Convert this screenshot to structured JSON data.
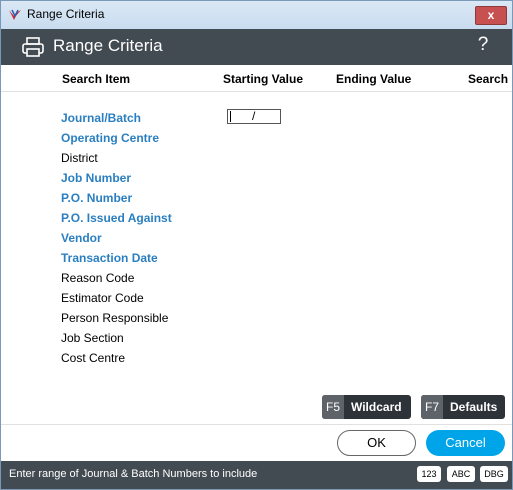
{
  "window": {
    "title": "Range Criteria",
    "close_label": "x"
  },
  "header": {
    "title": "Range Criteria",
    "help_label": "?"
  },
  "columns": {
    "search_item": "Search Item",
    "starting_value": "Starting Value",
    "ending_value": "Ending Value",
    "search": "Search"
  },
  "items": [
    {
      "label": "Journal/Batch",
      "active": true
    },
    {
      "label": "Operating Centre",
      "active": true
    },
    {
      "label": "District",
      "active": false
    },
    {
      "label": "Job Number",
      "active": true
    },
    {
      "label": "P.O. Number",
      "active": true
    },
    {
      "label": "P.O. Issued Against",
      "active": true
    },
    {
      "label": "Vendor",
      "active": true
    },
    {
      "label": "Transaction Date",
      "active": true
    },
    {
      "label": "Reason Code",
      "active": false
    },
    {
      "label": "Estimator Code",
      "active": false
    },
    {
      "label": "Person Responsible",
      "active": false
    },
    {
      "label": "Job Section",
      "active": false
    },
    {
      "label": "Cost Centre",
      "active": false
    }
  ],
  "journal_batch_field": {
    "separator": "/"
  },
  "function_buttons": {
    "wildcard": {
      "key": "F5",
      "label": "Wildcard"
    },
    "defaults": {
      "key": "F7",
      "label": "Defaults"
    }
  },
  "dialog_buttons": {
    "ok": "OK",
    "cancel": "Cancel"
  },
  "status_bar": {
    "message": "Enter range of Journal & Batch Numbers to include",
    "badges": [
      "123",
      "ABC",
      "DBG"
    ]
  },
  "colors": {
    "header_bg": "#424a52",
    "active_item": "#2a7fc1",
    "cancel_button": "#00a4e8",
    "close_button": "#c75050"
  }
}
